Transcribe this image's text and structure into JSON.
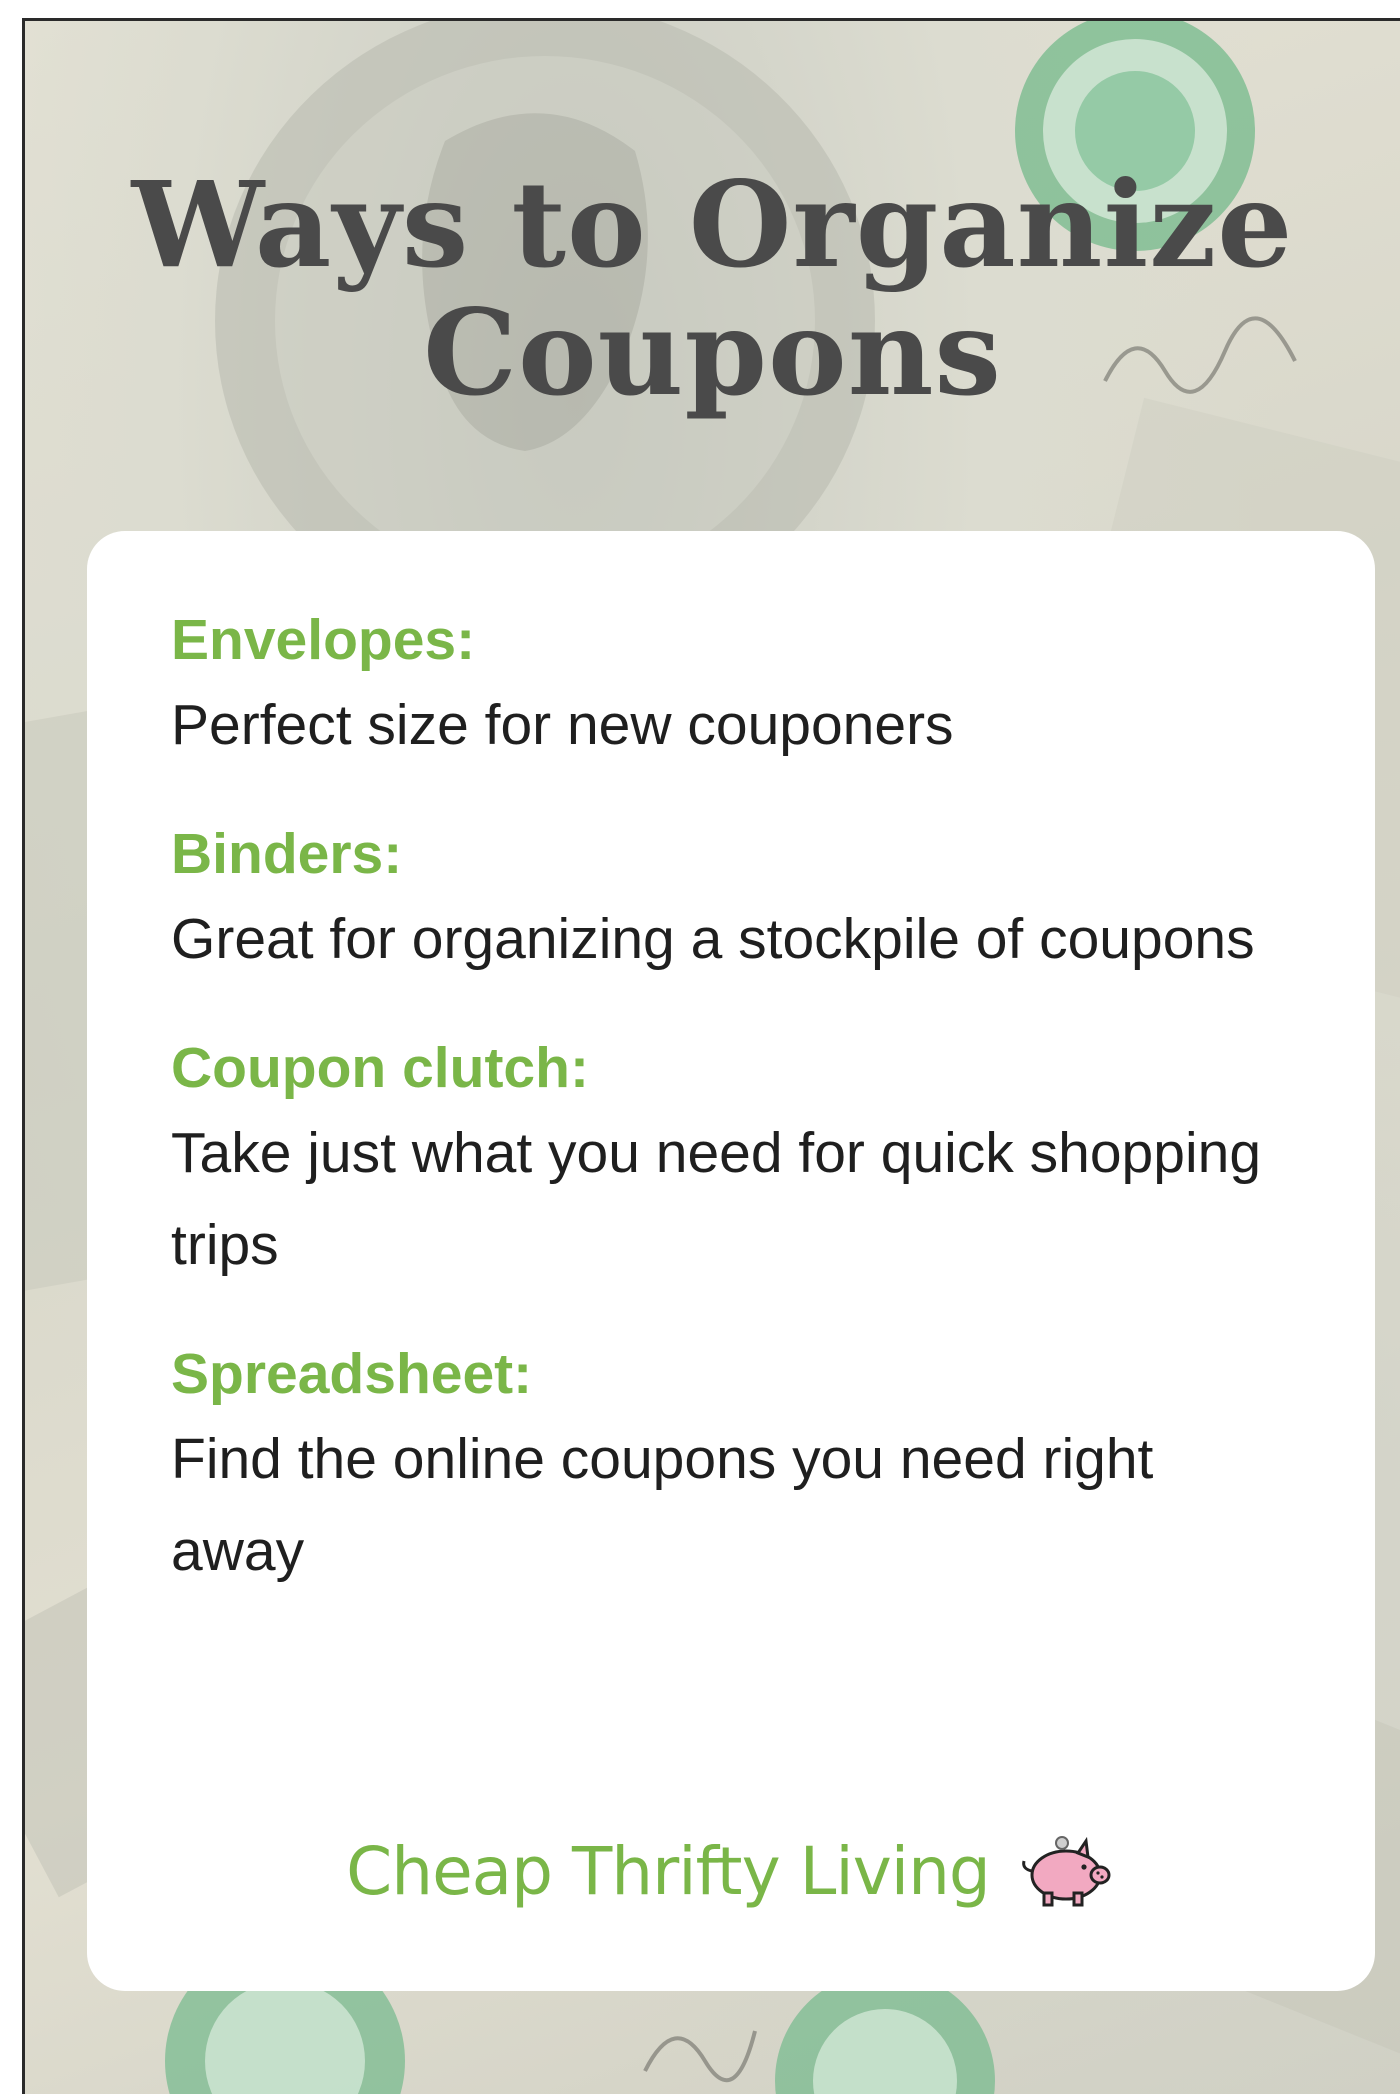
{
  "title": {
    "line1": "Ways to Organize",
    "line2": "Coupons"
  },
  "items": [
    {
      "title": "Envelopes:",
      "description": "Perfect size for new couponers"
    },
    {
      "title": "Binders:",
      "description": "Great for organizing a stockpile of coupons"
    },
    {
      "title": "Coupon clutch:",
      "description": "Take just what you need for quick shopping trips"
    },
    {
      "title": "Spreadsheet:",
      "description": "Find the online coupons you need right away"
    }
  ],
  "brand": {
    "name": "Cheap Thrifty Living",
    "icon": "piggy-bank-icon"
  },
  "colors": {
    "accent_green": "#7ab648",
    "title_gray": "#4a4a4a",
    "body_text": "#1f1f1f",
    "card_background": "#ffffff",
    "seal_green": "#5fae7a"
  }
}
